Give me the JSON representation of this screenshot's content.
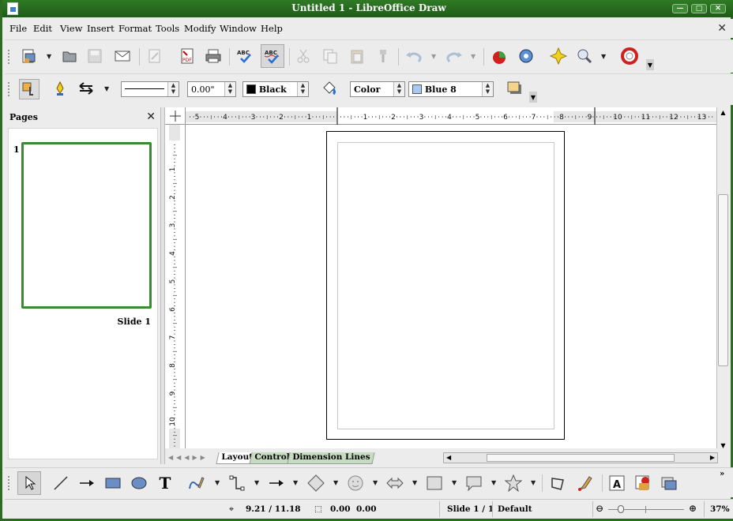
{
  "window": {
    "title": "Untitled  1  -  LibreOffice  Draw"
  },
  "menus": [
    "File",
    "Edit",
    "View",
    "Insert",
    "Format",
    "Tools",
    "Modify",
    "Window",
    "Help"
  ],
  "line_props": {
    "width_value": "0.00\"",
    "line_color": "Black",
    "line_color_hex": "#000000",
    "area_style": "Color",
    "area_color": "Blue 8",
    "area_color_hex": "#a6caf0"
  },
  "hruler_labels": [
    "5",
    "4",
    "3",
    "2",
    "1",
    "1",
    "2",
    "3",
    "4",
    "5",
    "6",
    "7",
    "8",
    "9",
    "10",
    "11",
    "12",
    "13"
  ],
  "vruler_labels": [
    "1",
    "2",
    "3",
    "4",
    "5",
    "6",
    "7",
    "8",
    "9",
    "10"
  ],
  "pages_panel": {
    "title": "Pages",
    "page_number": "1",
    "slide_label": "Slide  1"
  },
  "tabs": [
    "Layout",
    "Controls",
    "Dimension Lines"
  ],
  "status": {
    "position": "9.21 / 11.18",
    "size_w": "0.00",
    "size_h": "0.00",
    "slide": "Slide  1 / 1",
    "layout": "Default",
    "zoom": "37%"
  },
  "colors": {
    "accent": "#2d6b22",
    "selection_frame": "#3a8a35"
  }
}
